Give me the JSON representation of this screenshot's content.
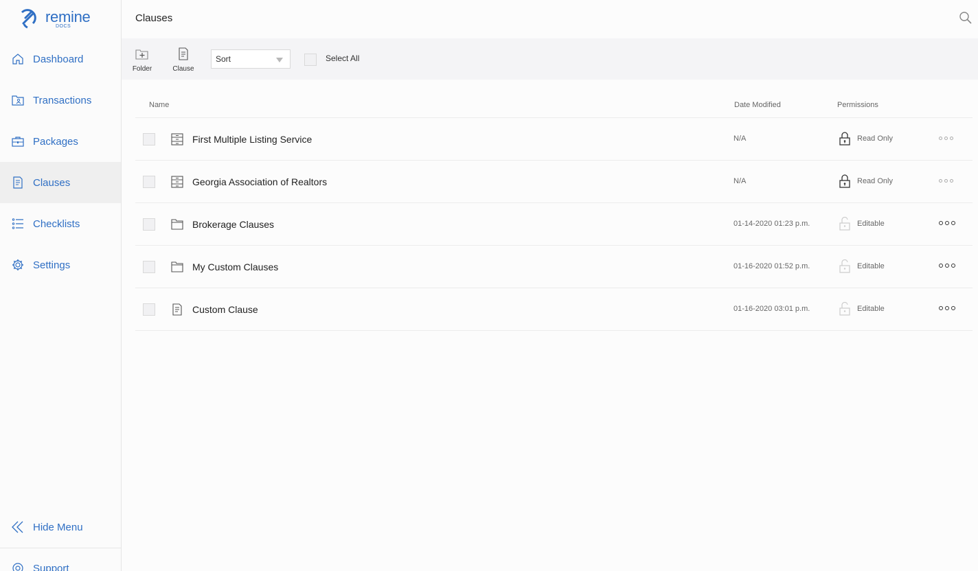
{
  "app": {
    "logo_word": "remine",
    "logo_sub": "DOCS"
  },
  "sidebar": {
    "items": [
      {
        "label": "Dashboard",
        "icon": "home-icon"
      },
      {
        "label": "Transactions",
        "icon": "folder-person-icon"
      },
      {
        "label": "Packages",
        "icon": "briefcase-icon"
      },
      {
        "label": "Clauses",
        "icon": "document-icon"
      },
      {
        "label": "Checklists",
        "icon": "list-icon"
      },
      {
        "label": "Settings",
        "icon": "gear-icon"
      }
    ],
    "hide_menu_label": "Hide Menu",
    "support_label": "Support"
  },
  "header": {
    "title": "Clauses",
    "search_icon": "search-icon"
  },
  "toolbar": {
    "folder_label": "Folder",
    "clause_label": "Clause",
    "sort_value": "Sort",
    "select_all_label": "Select All"
  },
  "table": {
    "columns": {
      "name": "Name",
      "date": "Date Modified",
      "permissions": "Permissions"
    },
    "rows": [
      {
        "name": "First Multiple Listing Service",
        "type": "cabinet",
        "date": "N/A",
        "permission": "Read Only"
      },
      {
        "name": "Georgia Association of Realtors",
        "type": "cabinet",
        "date": "N/A",
        "permission": "Read Only"
      },
      {
        "name": "Brokerage Clauses",
        "type": "folder",
        "date": "01-14-2020 01:23 p.m.",
        "permission": "Editable"
      },
      {
        "name": "My Custom Clauses",
        "type": "folder",
        "date": "01-16-2020 01:52 p.m.",
        "permission": "Editable"
      },
      {
        "name": "Custom Clause",
        "type": "document",
        "date": "01-16-2020 03:01 p.m.",
        "permission": "Editable"
      }
    ]
  },
  "colors": {
    "brand": "#2f6fc4",
    "active_nav_bg": "#efefef",
    "toolbar_bg": "#f4f4f6"
  }
}
